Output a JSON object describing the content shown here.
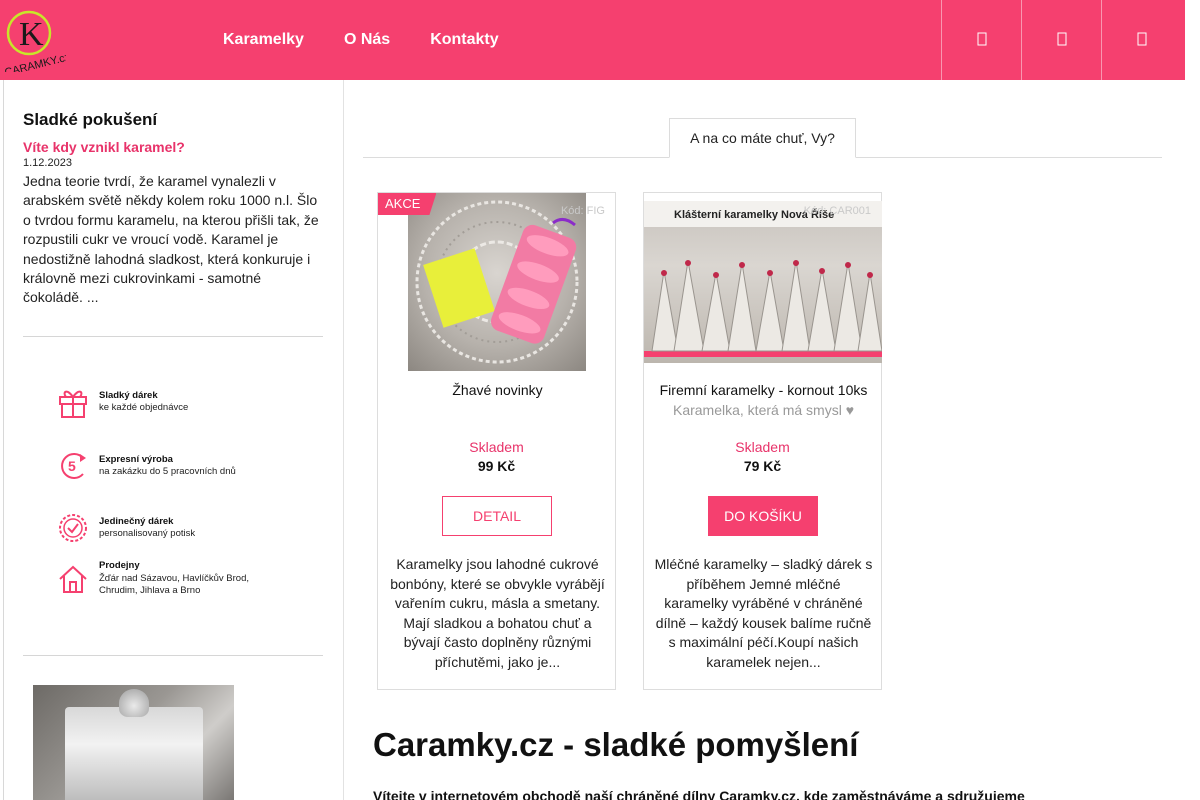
{
  "brand": {
    "logo_letter": "K",
    "logo_text": "CARAMKY.cz",
    "accent": "#f5406f",
    "link_color": "#e8336a"
  },
  "nav": {
    "items": [
      "Karamelky",
      "O Nás",
      "Kontakty"
    ]
  },
  "header_buttons": [
    "user-icon",
    "search-icon",
    "cart-icon"
  ],
  "sidebar": {
    "title": "Sladké pokušení",
    "article": {
      "link": "Víte kdy vznikl karamel?",
      "date": "1.12.2023",
      "text": "Jedna teorie tvrdí, že karamel vynalezli v arabském světě někdy kolem roku 1000 n.l. Šlo o tvrdou formu karamelu, na kterou přišli tak, že rozpustili cukr ve vroucí vodě. Karamel je nedostižně lahodná sladkost, která konkuruje i královně mezi cukrovinkami - samotné čokoládě.  ..."
    },
    "features": [
      {
        "icon": "gift-icon",
        "title": "Sladký dárek",
        "sub": "ke každé objednávce"
      },
      {
        "icon": "express-5-icon",
        "title": "Expresní výroba",
        "sub": "na zakázku do 5 pracovních dnů"
      },
      {
        "icon": "badge-check-icon",
        "title": "Jedinečný dárek",
        "sub": "personalisovaný potisk"
      },
      {
        "icon": "home-icon",
        "title": "Prodejny",
        "sub": "Žďár nad Sázavou, Havlíčkův Brod,",
        "sub2": "Chrudim, Jihlava a Brno"
      }
    ]
  },
  "tabs": {
    "active": "A na co máte chuť, Vy?"
  },
  "products": [
    {
      "badge": "AKCE",
      "code": "Kód: FIG",
      "name": "Žhavé novinky",
      "subtitle": "",
      "stock": "Skladem",
      "price": "99 Kč",
      "button": "DETAIL",
      "description": "Karamelky jsou lahodné cukrové bonbóny, které se obvykle vyrábějí vařením cukru, másla a smetany. Mají sladkou a bohatou chuť a bývají často doplněny různými příchutěmi, jako je..."
    },
    {
      "badge": "",
      "code": "Kód: CAR001",
      "image_caption": "Klášterní karamelky Nová Říše",
      "name": "Firemní karamelky - kornout 10ks",
      "subtitle": "Karamelka, která má smysl ♥",
      "stock": "Skladem",
      "price": "79 Kč",
      "button": "DO KOŠÍKU",
      "description": "  Mléčné karamelky – sladký dárek s příběhem   Jemné mléčné karamelky vyráběné v chráněné dílně – každý kousek balíme ručně s maximální péčí.Koupí našich karamelek nejen..."
    }
  ],
  "main": {
    "heading": "Caramky.cz - sladké pomyšlení",
    "intro": "Vítejte v internetovém obchodě naší chráněné dílny Caramky.cz, kde zaměstnáváme a sdružujeme"
  }
}
